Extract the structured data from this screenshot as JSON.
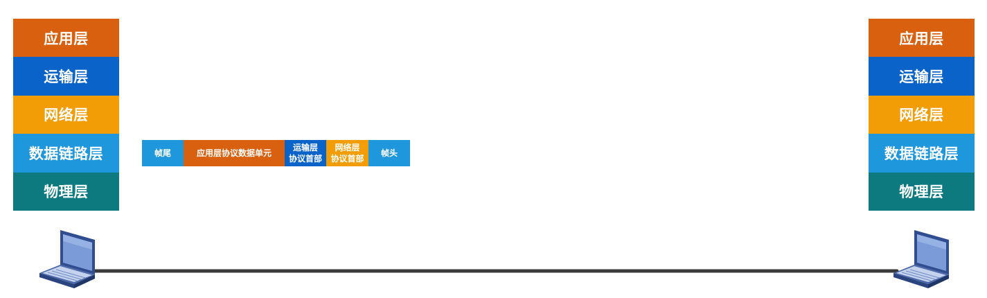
{
  "left_stack": {
    "layers": [
      {
        "label": "应用层",
        "color": "#d9600f"
      },
      {
        "label": "运输层",
        "color": "#0a63c9"
      },
      {
        "label": "网络层",
        "color": "#f39d06"
      },
      {
        "label": "数据链路层",
        "color": "#1e97dd"
      },
      {
        "label": "物理层",
        "color": "#0c7a7f"
      }
    ]
  },
  "right_stack": {
    "layers": [
      {
        "label": "应用层",
        "color": "#d9600f"
      },
      {
        "label": "运输层",
        "color": "#0a63c9"
      },
      {
        "label": "网络层",
        "color": "#f39d06"
      },
      {
        "label": "数据链路层",
        "color": "#1e97dd"
      },
      {
        "label": "物理层",
        "color": "#0c7a7f"
      }
    ]
  },
  "frame": {
    "trailer": "帧尾",
    "app_data": "应用层协议数据单元",
    "transport_header": {
      "line1": "运输层",
      "line2": "协议首部"
    },
    "network_header": {
      "line1": "网络层",
      "line2": "协议首部"
    },
    "header": "帧头"
  },
  "link": {
    "color": "#3a3a3a"
  },
  "devices": {
    "left_icon": "laptop-icon",
    "right_icon": "laptop-icon"
  }
}
